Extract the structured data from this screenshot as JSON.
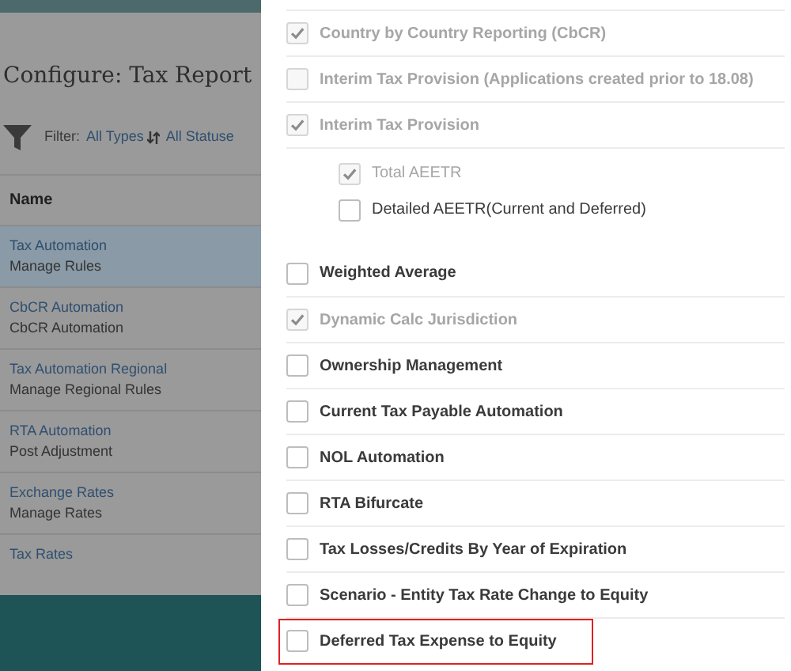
{
  "page": {
    "title": "Configure: Tax Report",
    "filter": {
      "label": "Filter:",
      "values": [
        "All Types",
        "All Statuse"
      ]
    },
    "table": {
      "columns": [
        "Name"
      ],
      "rows": [
        {
          "title": "Tax Automation",
          "subtitle": "Manage Rules",
          "selected": true
        },
        {
          "title": "CbCR Automation",
          "subtitle": "CbCR Automation",
          "selected": false
        },
        {
          "title": "Tax Automation Regional",
          "subtitle": "Manage Regional Rules",
          "selected": false
        },
        {
          "title": "RTA Automation",
          "subtitle": "Post Adjustment",
          "selected": false
        },
        {
          "title": "Exchange Rates",
          "subtitle": "Manage Rates",
          "selected": false
        },
        {
          "title": "Tax Rates",
          "selected": false
        }
      ]
    }
  },
  "options": [
    {
      "label": "Country by Country Reporting (CbCR)",
      "checked": true,
      "disabled": true,
      "highlighted": false
    },
    {
      "label": "Interim Tax Provision (Applications created prior to 18.08)",
      "checked": false,
      "disabled": true,
      "highlighted": false
    },
    {
      "label": "Interim Tax Provision",
      "checked": true,
      "disabled": true,
      "highlighted": false,
      "children": [
        {
          "label": "Total AEETR",
          "checked": true,
          "disabled": true
        },
        {
          "label": "Detailed AEETR(Current and Deferred)",
          "checked": false,
          "disabled": false
        }
      ]
    },
    {
      "label": "Weighted Average",
      "checked": false,
      "disabled": false,
      "highlighted": false
    },
    {
      "label": "Dynamic Calc Jurisdiction",
      "checked": true,
      "disabled": true,
      "highlighted": false
    },
    {
      "label": "Ownership Management",
      "checked": false,
      "disabled": false,
      "highlighted": false
    },
    {
      "label": "Current Tax Payable Automation",
      "checked": false,
      "disabled": false,
      "highlighted": false
    },
    {
      "label": "NOL Automation",
      "checked": false,
      "disabled": false,
      "highlighted": false
    },
    {
      "label": "RTA Bifurcate",
      "checked": false,
      "disabled": false,
      "highlighted": false
    },
    {
      "label": "Tax Losses/Credits By Year of Expiration",
      "checked": false,
      "disabled": false,
      "highlighted": false
    },
    {
      "label": "Scenario - Entity Tax Rate Change to Equity",
      "checked": false,
      "disabled": false,
      "highlighted": false
    },
    {
      "label": "Deferred Tax Expense to Equity",
      "checked": false,
      "disabled": false,
      "highlighted": true
    }
  ]
}
